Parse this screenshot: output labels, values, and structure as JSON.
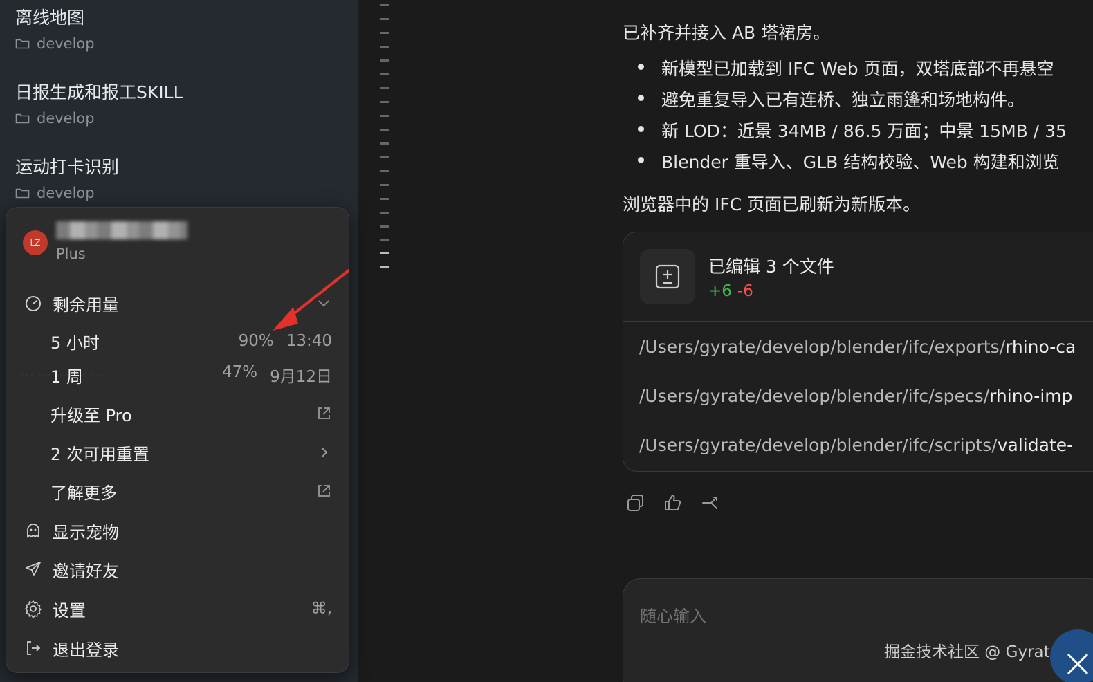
{
  "sidebar": {
    "conversations": [
      {
        "title": "离线地图",
        "folder": "develop"
      },
      {
        "title": "日报生成和报工SKILL",
        "folder": "develop"
      },
      {
        "title": "运动打卡识别",
        "folder": "develop"
      }
    ]
  },
  "account_menu": {
    "avatar_initials": "LZ",
    "plan": "Plus",
    "usage": {
      "label": "剩余用量",
      "rows": [
        {
          "label": "5 小时",
          "percent": "90%",
          "reset": "13:40"
        },
        {
          "label": "1 周",
          "percent": "47%",
          "reset": "9月12日"
        }
      ]
    },
    "upgrade_label": "升级至 Pro",
    "resets_label": "2 次可用重置",
    "learn_more_label": "了解更多",
    "show_pet_label": "显示宠物",
    "invite_label": "邀请好友",
    "settings_label": "设置",
    "settings_shortcut": "⌘,",
    "logout_label": "退出登录"
  },
  "chat": {
    "intro": "已补齐并接入 AB 塔裙房。",
    "bullets": [
      "新模型已加载到 IFC Web 页面，双塔底部不再悬空",
      "避免重复导入已有连桥、独立雨篷和场地构件。",
      "新 LOD：近景 34MB / 86.5 万面；中景 15MB / 35",
      "Blender 重导入、GLB 结构校验、Web 构建和浏览"
    ],
    "outro": "浏览器中的 IFC 页面已刷新为新版本。",
    "file_card": {
      "title": "已编辑 3 个文件",
      "additions": "+6",
      "deletions": "-6",
      "files": [
        {
          "dir": "/Users/gyrate/develop/blender/ifc/exports/",
          "name": "rhino-ca"
        },
        {
          "dir": "/Users/gyrate/develop/blender/ifc/specs/",
          "name": "rhino-imp"
        },
        {
          "dir": "/Users/gyrate/develop/blender/ifc/scripts/",
          "name": "validate-"
        }
      ]
    },
    "composer_placeholder": "随心输入",
    "watermark": "掘金技术社区 @ Gyrate"
  }
}
